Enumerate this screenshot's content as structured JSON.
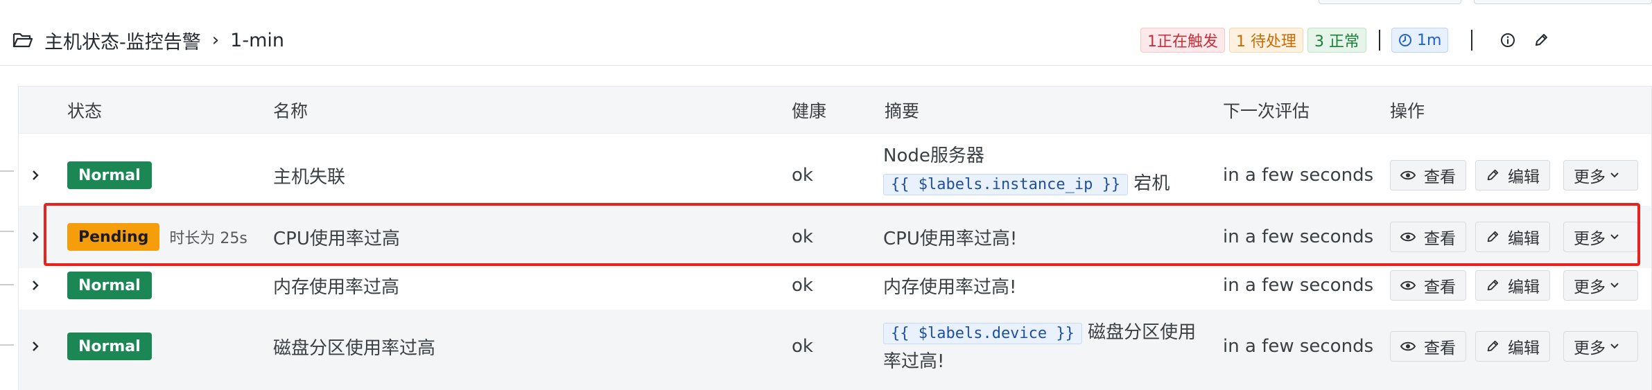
{
  "header": {
    "folder_icon": "folder-open-icon",
    "breadcrumb_parent": "主机状态-监控告警",
    "breadcrumb_sep": "›",
    "breadcrumb_current": "1-min",
    "badges": {
      "firing": "1正在触发",
      "pending": "1 待处理",
      "normal": "3 正常"
    },
    "interval_icon": "clock-icon",
    "interval": "1m",
    "info_icon": "info-icon",
    "edit_icon": "pencil-icon"
  },
  "table": {
    "columns": {
      "state": "状态",
      "name": "名称",
      "health": "健康",
      "summary": "摘要",
      "next_eval": "下一次评估",
      "actions": "操作"
    },
    "rows": [
      {
        "state": "Normal",
        "duration": "",
        "name": "主机失联",
        "health": "ok",
        "summary_prefix": "Node服务器",
        "summary_code": "{{ $labels.instance_ip }}",
        "summary_suffix": "宕机",
        "next_eval": "in a few seconds"
      },
      {
        "state": "Pending",
        "duration": "时长为 25s",
        "name": "CPU使用率过高",
        "health": "ok",
        "summary_text": "CPU使用率过高!",
        "next_eval": "in a few seconds"
      },
      {
        "state": "Normal",
        "duration": "",
        "name": "内存使用率过高",
        "health": "ok",
        "summary_text": "内存使用率过高!",
        "next_eval": "in a few seconds"
      },
      {
        "state": "Normal",
        "duration": "",
        "name": "磁盘分区使用率过高",
        "health": "ok",
        "summary_code": "{{ $labels.device }}",
        "summary_suffix": "磁盘分区使用",
        "summary_line2": "率过高!",
        "next_eval": "in a few seconds"
      }
    ],
    "actions": {
      "view": "查看",
      "edit": "编辑",
      "more": "更多"
    }
  },
  "colors": {
    "normal": "#1a8754",
    "pending": "#f59d0a",
    "highlight": "#e5241f"
  }
}
